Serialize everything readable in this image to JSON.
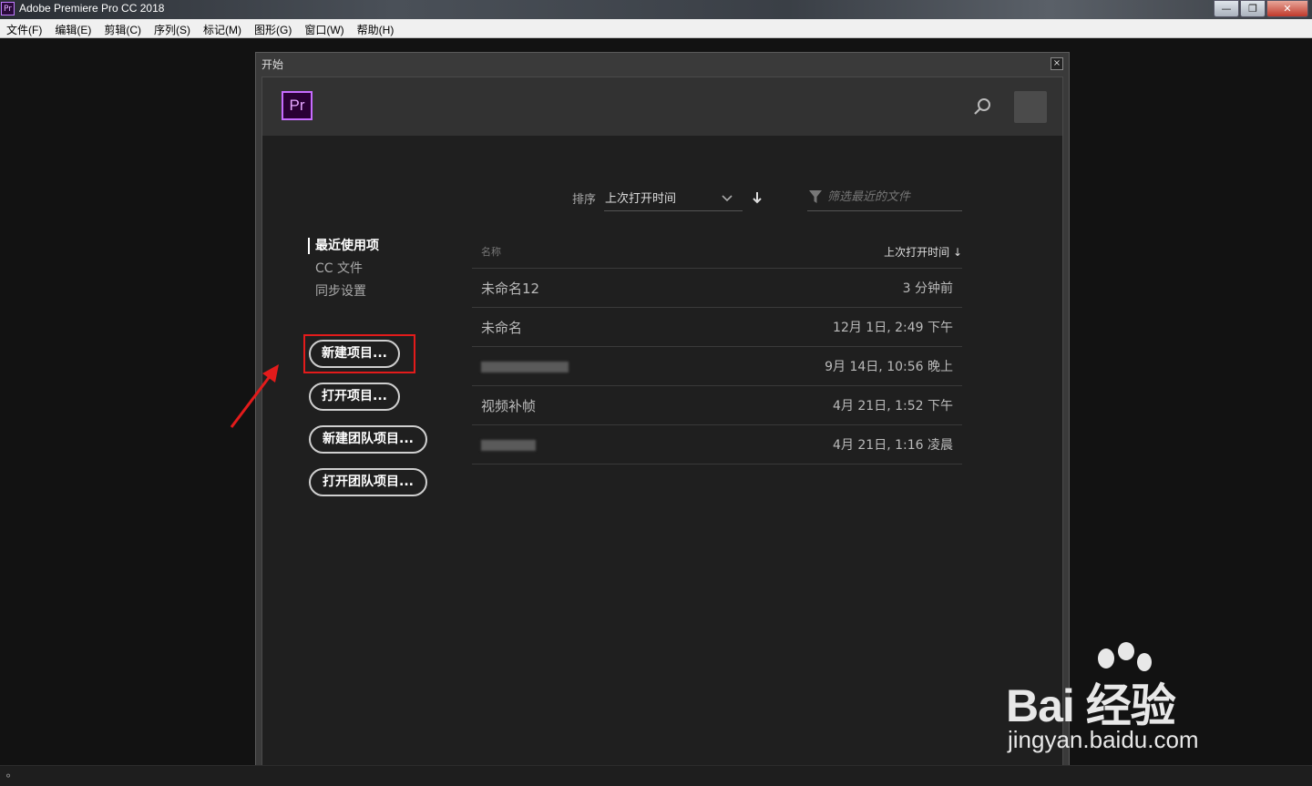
{
  "window": {
    "app_icon": "Pr",
    "title": "Adobe Premiere Pro CC 2018",
    "controls": [
      "minimize-icon",
      "maximize-icon",
      "close-icon"
    ]
  },
  "menu": [
    {
      "label": "文件(F)"
    },
    {
      "label": "编辑(E)"
    },
    {
      "label": "剪辑(C)"
    },
    {
      "label": "序列(S)"
    },
    {
      "label": "标记(M)"
    },
    {
      "label": "图形(G)"
    },
    {
      "label": "窗口(W)"
    },
    {
      "label": "帮助(H)"
    }
  ],
  "dialog": {
    "title": "开始",
    "close": "×",
    "logo": "Pr",
    "sort": {
      "label": "排序",
      "value": "上次打开时间"
    },
    "filter": {
      "placeholder": "筛选最近的文件"
    },
    "nav": [
      {
        "label": "最近使用项",
        "active": true
      },
      {
        "label": "CC 文件",
        "active": false
      },
      {
        "label": "同步设置",
        "active": false
      }
    ],
    "buttons": {
      "new_project": "新建项目...",
      "open_project": "打开项目...",
      "new_team_project": "新建团队项目...",
      "open_team_project": "打开团队项目..."
    },
    "table": {
      "col_name": "名称",
      "col_time": "上次打开时间 ↓",
      "rows": [
        {
          "name": "未命名12",
          "time": "3 分钟前"
        },
        {
          "name": "未命名",
          "time": "12月 1日, 2:49 下午"
        },
        {
          "name": "",
          "time": "9月 14日, 10:56 晚上"
        },
        {
          "name": "视频补帧",
          "time": "4月 21日, 1:52 下午"
        },
        {
          "name": "",
          "time": "4月 21日, 1:16 凌晨"
        }
      ]
    }
  },
  "watermark": {
    "logo": "Bai 经验",
    "url": "jingyan.baidu.com"
  },
  "colors": {
    "highlight": "#e31b1b",
    "pr_purple": "#c76bff"
  }
}
